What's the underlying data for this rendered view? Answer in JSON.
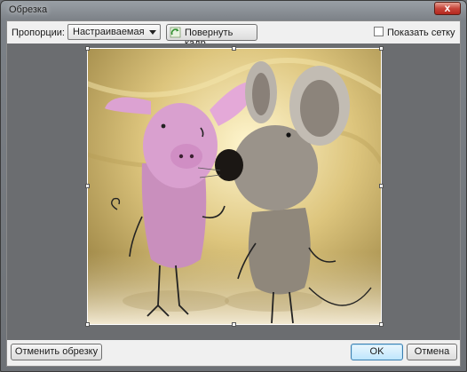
{
  "window": {
    "title": "Обрезка",
    "close_label": "x"
  },
  "toolbar": {
    "proportions_label": "Пропорции:",
    "proportions_value": "Настраиваемая",
    "rotate_label": "Повернуть кадр",
    "show_grid_label": "Показать сетку",
    "show_grid_checked": false
  },
  "image": {
    "subject": "felt pig and mouse toys"
  },
  "footer": {
    "cancel_crop_label": "Отменить обрезку",
    "ok_label": "OK",
    "cancel_label": "Отмена"
  }
}
